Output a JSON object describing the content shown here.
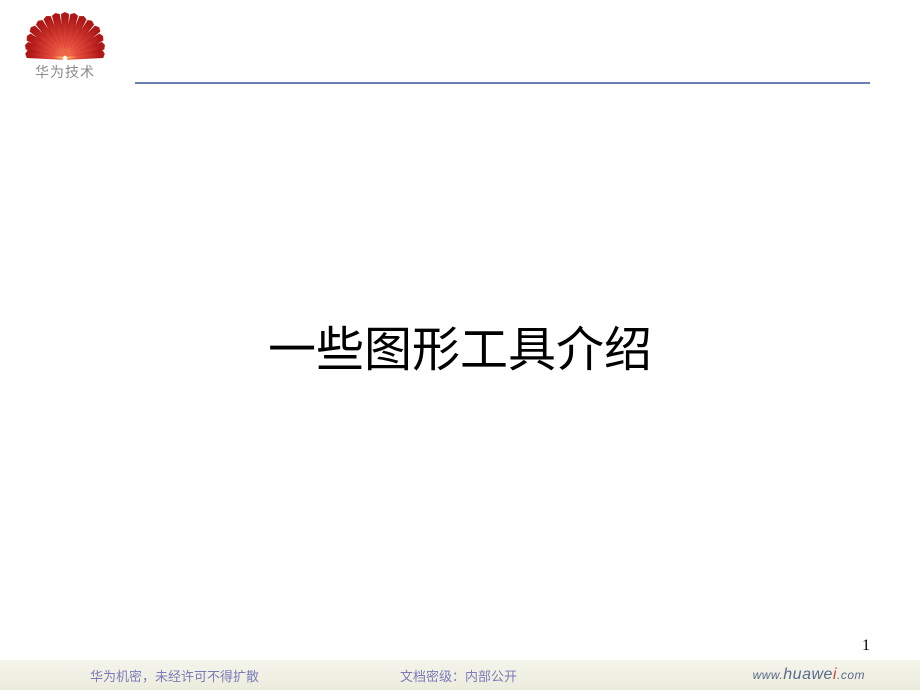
{
  "header": {
    "logo_text": "华为技术"
  },
  "main": {
    "title": "一些图形工具介绍"
  },
  "page_number": "1",
  "footer": {
    "left": "华为机密，未经许可不得扩散",
    "center": "文档密级：内部公开",
    "right_prefix": "www.",
    "right_main": "huawe",
    "right_i": "i",
    "right_suffix": ".com"
  }
}
